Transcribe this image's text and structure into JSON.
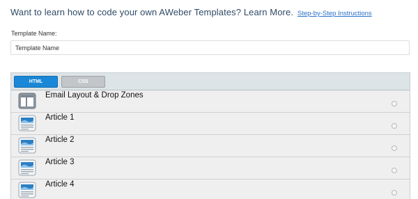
{
  "header": {
    "headline": "Want to learn how to code your own AWeber Templates? Learn More.",
    "link_label": "Step-by-Step Instructions"
  },
  "template_name": {
    "label": "Template Name:",
    "placeholder": "Template Name",
    "value": ""
  },
  "tabs": [
    {
      "label": "HTML",
      "active": true
    },
    {
      "label": "CSS",
      "active": false
    }
  ],
  "blocks": [
    {
      "title": "Email Layout & Drop Zones",
      "icon": "layout-icon"
    },
    {
      "title": "Article 1",
      "icon": "article-icon"
    },
    {
      "title": "Article 2",
      "icon": "article-icon"
    },
    {
      "title": "Article 3",
      "icon": "article-icon"
    },
    {
      "title": "Article 4",
      "icon": "article-icon"
    }
  ],
  "colors": {
    "headline": "#2f4a66",
    "link": "#2a6fc7",
    "active_tab": "#1a88d6",
    "inactive_tab": "#c3c6c8"
  }
}
